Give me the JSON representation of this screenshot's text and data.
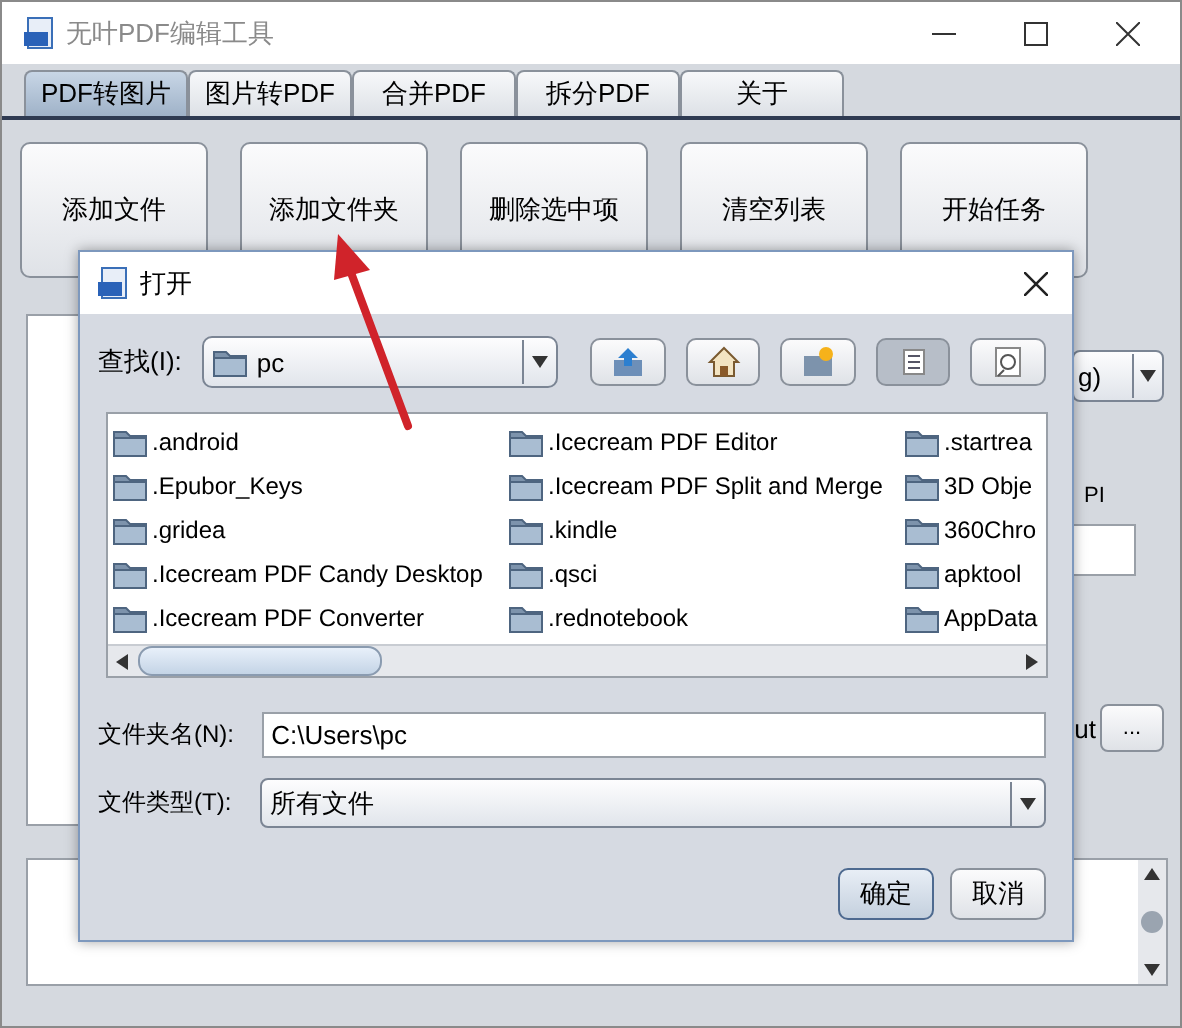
{
  "window": {
    "title": "无叶PDF编辑工具"
  },
  "tabs": [
    {
      "label": "PDF转图片",
      "selected": true
    },
    {
      "label": "图片转PDF",
      "selected": false
    },
    {
      "label": "合并PDF",
      "selected": false
    },
    {
      "label": "拆分PDF",
      "selected": false
    },
    {
      "label": "关于",
      "selected": false
    }
  ],
  "toolbar": {
    "buttons": [
      "添加文件",
      "添加文件夹",
      "删除选中项",
      "清空列表",
      "开始任务"
    ]
  },
  "options_panel": {
    "format_select": "g)",
    "label": "PI",
    "output_label": "ut",
    "browse_button": "..."
  },
  "dialog": {
    "title": "打开",
    "look_in": {
      "label": "查找(I):",
      "value": "pc"
    },
    "tool_buttons": [
      {
        "kind": "up",
        "selected": false
      },
      {
        "kind": "home",
        "selected": false
      },
      {
        "kind": "new-folder",
        "selected": false
      },
      {
        "kind": "list",
        "selected": true
      },
      {
        "kind": "details",
        "selected": false
      }
    ],
    "files": [
      ".android",
      ".Epubor_Keys",
      ".gridea",
      ".Icecream PDF Candy Desktop",
      ".Icecream PDF Converter",
      ".Icecream PDF Editor",
      ".Icecream PDF Split and Merge",
      ".kindle",
      ".qsci",
      ".rednotebook",
      ".startrea",
      "3D Obje",
      "360Chro",
      "apktool",
      "AppData"
    ],
    "file_name": {
      "label": "文件夹名(N):",
      "value": "C:\\Users\\pc"
    },
    "file_type": {
      "label": "文件类型(T):",
      "value": "所有文件"
    },
    "buttons": [
      {
        "label": "确定",
        "selected": true
      },
      {
        "label": "取消",
        "selected": false
      }
    ]
  }
}
